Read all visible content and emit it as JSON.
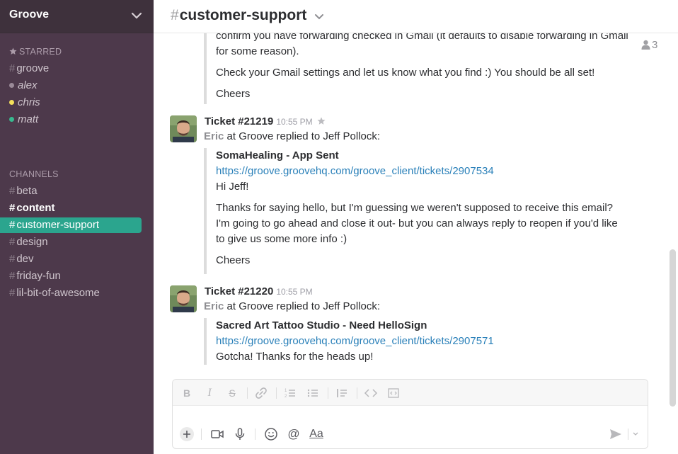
{
  "workspace": {
    "name": "Groove"
  },
  "sidebar": {
    "starred_label": "STARRED",
    "starred": [
      {
        "label": "groove",
        "kind": "channel"
      },
      {
        "label": "alex",
        "kind": "dm",
        "presence": "#9a8a98"
      },
      {
        "label": "chris",
        "kind": "dm",
        "presence": "#f5e15b"
      },
      {
        "label": "matt",
        "kind": "dm",
        "presence": "#38b98f"
      }
    ],
    "channels_label": "CHANNELS",
    "channels": [
      {
        "label": "beta"
      },
      {
        "label": "content"
      },
      {
        "label": "customer-support"
      },
      {
        "label": "design"
      },
      {
        "label": "dev"
      },
      {
        "label": "friday-fun"
      },
      {
        "label": "lil-bit-of-awesome"
      }
    ]
  },
  "header": {
    "hash": "#",
    "channel": "customer-support",
    "member_count": "3"
  },
  "messages": {
    "top_quote": {
      "line1": "confirm you have forwarding checked in Gmail (it defaults to disable forwarding in Gmail for some reason).",
      "line2": "Check your Gmail settings and let us know what you find :) You should be all set!",
      "line3": "Cheers"
    },
    "ticket1": {
      "author": "Ticket #21219",
      "time": "10:55 PM",
      "sub_who": "Eric",
      "sub_rest": " at Groove replied to Jeff Pollock:",
      "title": "SomaHealing - App Sent",
      "link": "https://groove.groovehq.com/groove_client/tickets/2907534",
      "p1": "Hi Jeff!",
      "p2": "Thanks for saying hello, but I'm guessing we weren't supposed to receive this email? I'm going to go ahead and close it out- but you can always reply to reopen if you'd like to give us some more info :)",
      "p3": "Cheers"
    },
    "ticket2": {
      "author": "Ticket #21220",
      "time": "10:55 PM",
      "sub_who": "Eric",
      "sub_rest": " at Groove replied to Jeff Pollock:",
      "title": "Sacred Art Tattoo Studio - Need HelloSign",
      "link": "https://groove.groovehq.com/groove_client/tickets/2907571",
      "p1": "Gotcha! Thanks for the heads up!"
    }
  },
  "composer": {
    "format_tools": [
      "bold-icon",
      "italic-icon",
      "strikethrough-icon",
      "link-icon",
      "ordered-list-icon",
      "bullet-list-icon",
      "blockquote-icon",
      "code-icon",
      "code-block-icon"
    ],
    "bottom_tools": [
      "plus-icon",
      "video-icon",
      "microphone-icon",
      "emoji-icon",
      "mention-icon",
      "formatting-icon"
    ],
    "format_label": "Aa",
    "mention_label": "@"
  }
}
